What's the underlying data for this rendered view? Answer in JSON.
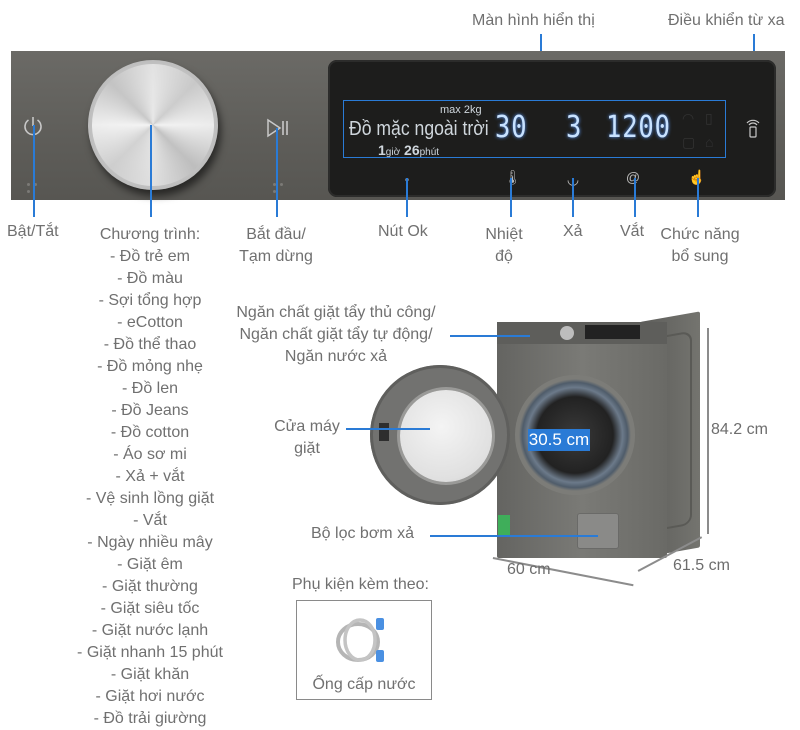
{
  "callouts": {
    "display": "Màn hình hiển thị",
    "remote": "Điều khiển từ xa",
    "power": "Bật/Tắt",
    "programs_title": "Chương trình:",
    "programs": [
      "- Đồ trẻ em",
      "- Đồ màu",
      "- Sợi tổng hợp",
      "- eCotton",
      "- Đồ thể thao",
      "- Đồ mỏng nhẹ",
      "- Đồ len",
      "- Đồ Jeans",
      "- Đồ cotton",
      "- Áo sơ mi",
      "- Xả + vắt",
      "- Vệ sinh lồng giặt",
      "- Vắt",
      "- Ngày nhiều mây",
      "- Giặt êm",
      "- Giặt thường",
      "- Giặt siêu tốc",
      "- Giặt nước lạnh",
      "- Giặt nhanh 15 phút",
      "- Giặt khăn",
      "- Giặt hơi nước",
      "- Đồ trải giường"
    ],
    "start_pause_1": "Bắt đầu/",
    "start_pause_2": "Tạm dừng",
    "ok_button": "Nút Ok",
    "temperature_1": "Nhiệt",
    "temperature_2": "độ",
    "rinse": "Xả",
    "spin": "Vắt",
    "extra_1": "Chức năng",
    "extra_2": "bổ sung",
    "detergent_1": "Ngăn chất giặt tẩy thủ công/",
    "detergent_2": "Ngăn chất giặt tẩy tự động/",
    "detergent_3": "Ngăn nước xả",
    "door_1": "Cửa máy",
    "door_2": "giặt",
    "filter": "Bộ lọc bơm xả"
  },
  "lcd": {
    "max_load": "max 2kg",
    "program_name": "Đồ mặc ngoài trời",
    "time_hours": "1",
    "time_hours_unit": "giờ",
    "time_minutes": "26",
    "time_minutes_unit": "phút",
    "temperature": "30",
    "rinse_count": "3",
    "spin_speed": "1200"
  },
  "dimensions": {
    "door_diameter": "30.5 cm",
    "height": "84.2 cm",
    "width": "60 cm",
    "depth": "61.5 cm"
  },
  "accessories": {
    "title": "Phụ kiện kèm theo:",
    "items": [
      "Ống cấp nước"
    ]
  },
  "colors": {
    "accent_line": "#2a7bd6",
    "panel": "#5e5d59",
    "lcd_digits": "#c8e2ff"
  }
}
